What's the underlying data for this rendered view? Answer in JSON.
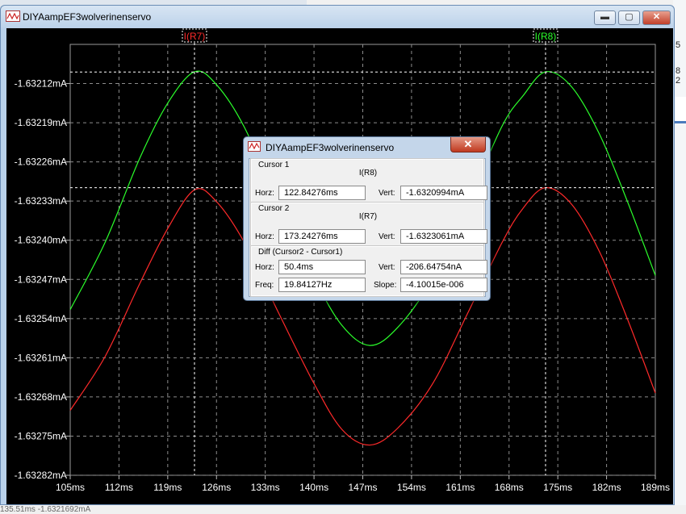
{
  "window": {
    "title": "DIYAampEF3wolverinenservo"
  },
  "traces": [
    {
      "label": "I(R7)",
      "color": "#ff2a2a"
    },
    {
      "label": "I(R8)",
      "color": "#2bff2b"
    }
  ],
  "chart_data": {
    "type": "line",
    "xunit": "ms",
    "yunit": "mA",
    "xlim": [
      105,
      189
    ],
    "ylim": [
      -1.63282,
      -1.63205
    ],
    "x_ticks": [
      "105ms",
      "112ms",
      "119ms",
      "126ms",
      "133ms",
      "140ms",
      "147ms",
      "154ms",
      "161ms",
      "168ms",
      "175ms",
      "182ms",
      "189ms"
    ],
    "y_ticks": [
      "-1.63212mA",
      "-1.63219mA",
      "-1.63226mA",
      "-1.63233mA",
      "-1.63240mA",
      "-1.63247mA",
      "-1.63254mA",
      "-1.63261mA",
      "-1.63268mA",
      "-1.63275mA",
      "-1.63282mA"
    ],
    "series": [
      {
        "name": "I(R7)",
        "color": "#ff2a2a",
        "x": [
          105,
          110,
          115,
          119,
          122.84,
          126,
          130,
          135,
          140,
          144,
          148,
          152,
          157,
          162,
          167,
          170,
          173.24,
          177,
          181,
          185,
          189
        ],
        "y": [
          -1.632704,
          -1.632608,
          -1.632477,
          -1.632379,
          -1.63231,
          -1.632331,
          -1.632404,
          -1.632532,
          -1.632656,
          -1.632738,
          -1.632766,
          -1.632736,
          -1.632657,
          -1.632532,
          -1.632404,
          -1.632343,
          -1.632306,
          -1.632336,
          -1.632421,
          -1.632541,
          -1.632673
        ]
      },
      {
        "name": "I(R8)",
        "color": "#2bff2b",
        "x": [
          105,
          110,
          115,
          119,
          122.84,
          126,
          130,
          135,
          140,
          144,
          148,
          152,
          157,
          162,
          167,
          170,
          173.24,
          177,
          181,
          185,
          189
        ],
        "y": [
          -1.632524,
          -1.632404,
          -1.632253,
          -1.632155,
          -1.632099,
          -1.632122,
          -1.632198,
          -1.632338,
          -1.632467,
          -1.632552,
          -1.632588,
          -1.632556,
          -1.632469,
          -1.632336,
          -1.632196,
          -1.632142,
          -1.632099,
          -1.632126,
          -1.632211,
          -1.632331,
          -1.632463
        ]
      }
    ],
    "cursors": [
      {
        "name": "cursor1",
        "x": 122.84,
        "y": -1.6320994,
        "trace": "I(R8)"
      },
      {
        "name": "cursor2",
        "x": 173.24,
        "y": -1.6323061,
        "trace": "I(R7)"
      }
    ],
    "grid": true
  },
  "dialog": {
    "title": "DIYAampEF3wolverinenservo",
    "close_glyph": "✕",
    "cursor1": {
      "heading": "Cursor 1",
      "trace": "I(R8)",
      "horz_label": "Horz:",
      "horz": "122.84276ms",
      "vert_label": "Vert:",
      "vert": "-1.6320994mA"
    },
    "cursor2": {
      "heading": "Cursor 2",
      "trace": "I(R7)",
      "horz_label": "Horz:",
      "horz": "173.24276ms",
      "vert_label": "Vert:",
      "vert": "-1.6323061mA"
    },
    "diff": {
      "heading": "Diff (Cursor2 - Cursor1)",
      "horz_label": "Horz:",
      "horz": "50.4ms",
      "vert_label": "Vert:",
      "vert": "-206.64754nA",
      "freq_label": "Freq:",
      "freq": "19.84127Hz",
      "slope_label": "Slope:",
      "slope": "-4.10015e-006"
    }
  },
  "background": {
    "right_char1": "5",
    "right_char2": "8",
    "right_char3": "2",
    "bottom_text": "135.51ms      -1.6321692mA"
  }
}
